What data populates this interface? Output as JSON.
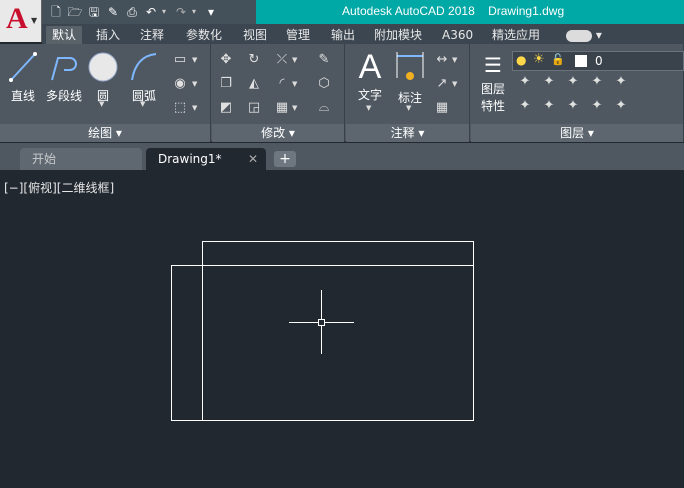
{
  "app": {
    "title": "Autodesk AutoCAD 2018    Drawing1.dwg",
    "logo_letter": "A",
    "colors": {
      "accent": "#00a8a6",
      "logo": "#c8102e",
      "canvas": "#212830"
    }
  },
  "quick_access": {
    "icons": [
      "new-icon",
      "open-icon",
      "save-icon",
      "saveas-icon",
      "print-icon",
      "undo-icon",
      "redo-icon",
      "more-icon"
    ]
  },
  "ribbon_tabs": [
    {
      "label": "默认",
      "active": true
    },
    {
      "label": "插入",
      "active": false
    },
    {
      "label": "注释",
      "active": false
    },
    {
      "label": "参数化",
      "active": false
    },
    {
      "label": "视图",
      "active": false
    },
    {
      "label": "管理",
      "active": false
    },
    {
      "label": "输出",
      "active": false
    },
    {
      "label": "附加模块",
      "active": false
    },
    {
      "label": "A360",
      "active": false
    },
    {
      "label": "精选应用",
      "active": false
    }
  ],
  "panels": {
    "draw": {
      "footer": "绘图 ▾",
      "tools": {
        "line": "直线",
        "polyline": "多段线",
        "circle": "圆",
        "arc": "圆弧"
      }
    },
    "modify": {
      "footer": "修改 ▾"
    },
    "annotation": {
      "footer": "注释 ▾",
      "tools": {
        "text": "文字",
        "dimension": "标注"
      }
    },
    "layers": {
      "footer": "图层 ▾",
      "tools": {
        "properties_line1": "图层",
        "properties_line2": "特性"
      },
      "current_layer": "0"
    }
  },
  "doc_tabs": [
    {
      "label": "开始",
      "active": false
    },
    {
      "label": "Drawing1*",
      "active": true
    }
  ],
  "viewport": {
    "control": "[−][俯视][二维线框]"
  }
}
